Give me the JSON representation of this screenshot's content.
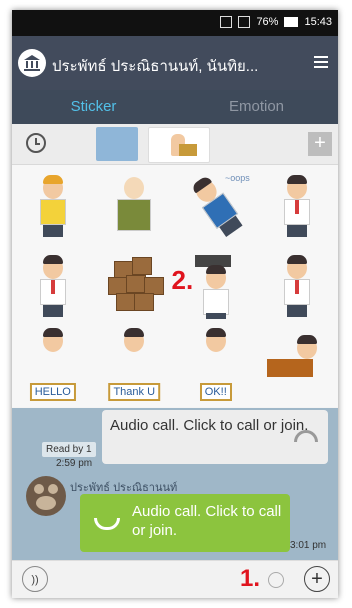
{
  "status_bar": {
    "battery": "76%",
    "time": "15:43"
  },
  "header": {
    "title": "ประพัทธ์  ประณิธานนท์, นันทิย..."
  },
  "tabs": [
    {
      "label": "Sticker",
      "active": true
    },
    {
      "label": "Emotion",
      "active": false
    }
  ],
  "stickers": {
    "hello_sign": "HELLO",
    "thanks_sign": "Thank U",
    "ok_sign": "OK!!",
    "oops_text": "~oops"
  },
  "annotations": {
    "two": "2.",
    "one": "1."
  },
  "chat": {
    "my_message": "Audio call. Click to call or join.",
    "read_status": "Read by 1",
    "my_time": "2:59 pm",
    "friend_name": "ประพัทธ์  ประณิธานนท์",
    "friend_message": "Audio call. Click to call or join.",
    "friend_time": "3:01 pm"
  },
  "colors": {
    "header": "#424b5c",
    "tab_active": "#52c0e8",
    "friend_bubble": "#8cc43e",
    "chat_bg": "#9fb7c8",
    "annotation": "#e0141e"
  }
}
